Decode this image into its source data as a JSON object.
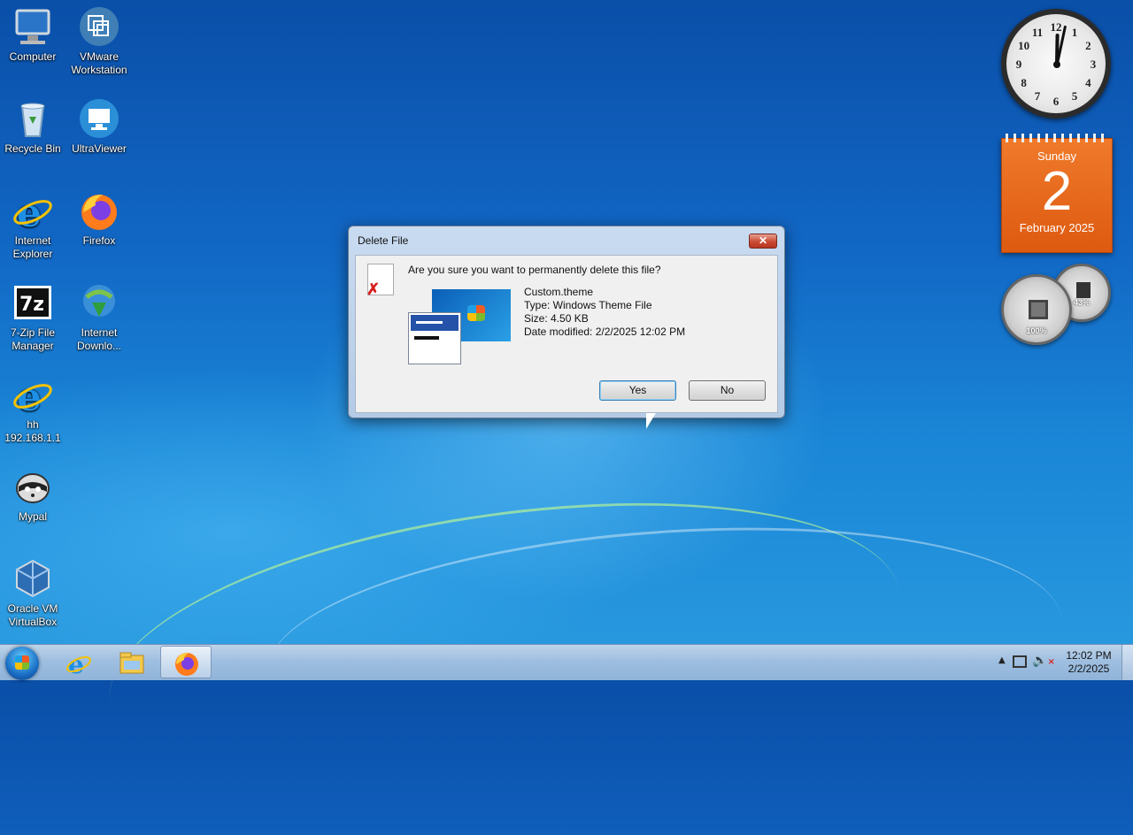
{
  "desktop": {
    "icons": [
      {
        "label": "Computer",
        "icon": "computer-icon"
      },
      {
        "label": "VMware Workstation",
        "icon": "vmware-icon"
      },
      {
        "label": "Recycle Bin",
        "icon": "recycle-bin-icon"
      },
      {
        "label": "UltraViewer",
        "icon": "ultraviewer-icon"
      },
      {
        "label": "Internet Explorer",
        "icon": "internet-explorer-icon"
      },
      {
        "label": "Firefox",
        "icon": "firefox-icon"
      },
      {
        "label": "7-Zip File Manager",
        "icon": "7zip-icon"
      },
      {
        "label": "Internet Downlo...",
        "icon": "idm-icon"
      },
      {
        "label": "hh 192.168.1.1",
        "icon": "ie-shortcut-icon"
      },
      {
        "label": "Mypal",
        "icon": "mypal-icon"
      },
      {
        "label": "Oracle VM VirtualBox",
        "icon": "virtualbox-icon"
      }
    ]
  },
  "gadgets": {
    "clock": {
      "numerals": [
        "12",
        "1",
        "2",
        "3",
        "4",
        "5",
        "6",
        "7",
        "8",
        "9",
        "10",
        "11"
      ],
      "time": "12:02"
    },
    "calendar": {
      "day": "Sunday",
      "date": "2",
      "month": "February 2025"
    },
    "cpu_meter": {
      "cpu": "100%",
      "memory": "43%"
    }
  },
  "dialog": {
    "title": "Delete File",
    "close_label": "✕",
    "question": "Are you sure you want to permanently delete this file?",
    "file_name": "Custom.theme",
    "file_type": "Type: Windows Theme File",
    "file_size": "Size: 4.50 KB",
    "date_modified": "Date modified: 2/2/2025 12:02 PM",
    "yes_label": "Yes",
    "no_label": "No"
  },
  "taskbar": {
    "pinned": [
      {
        "name": "internet-explorer",
        "icon": "ie-taskbar-icon"
      },
      {
        "name": "windows-explorer",
        "icon": "folder-icon"
      },
      {
        "name": "firefox",
        "icon": "firefox-taskbar-icon",
        "active": true
      }
    ],
    "tray": {
      "time": "12:02 PM",
      "date": "2/2/2025",
      "show_hidden": "▲"
    }
  }
}
